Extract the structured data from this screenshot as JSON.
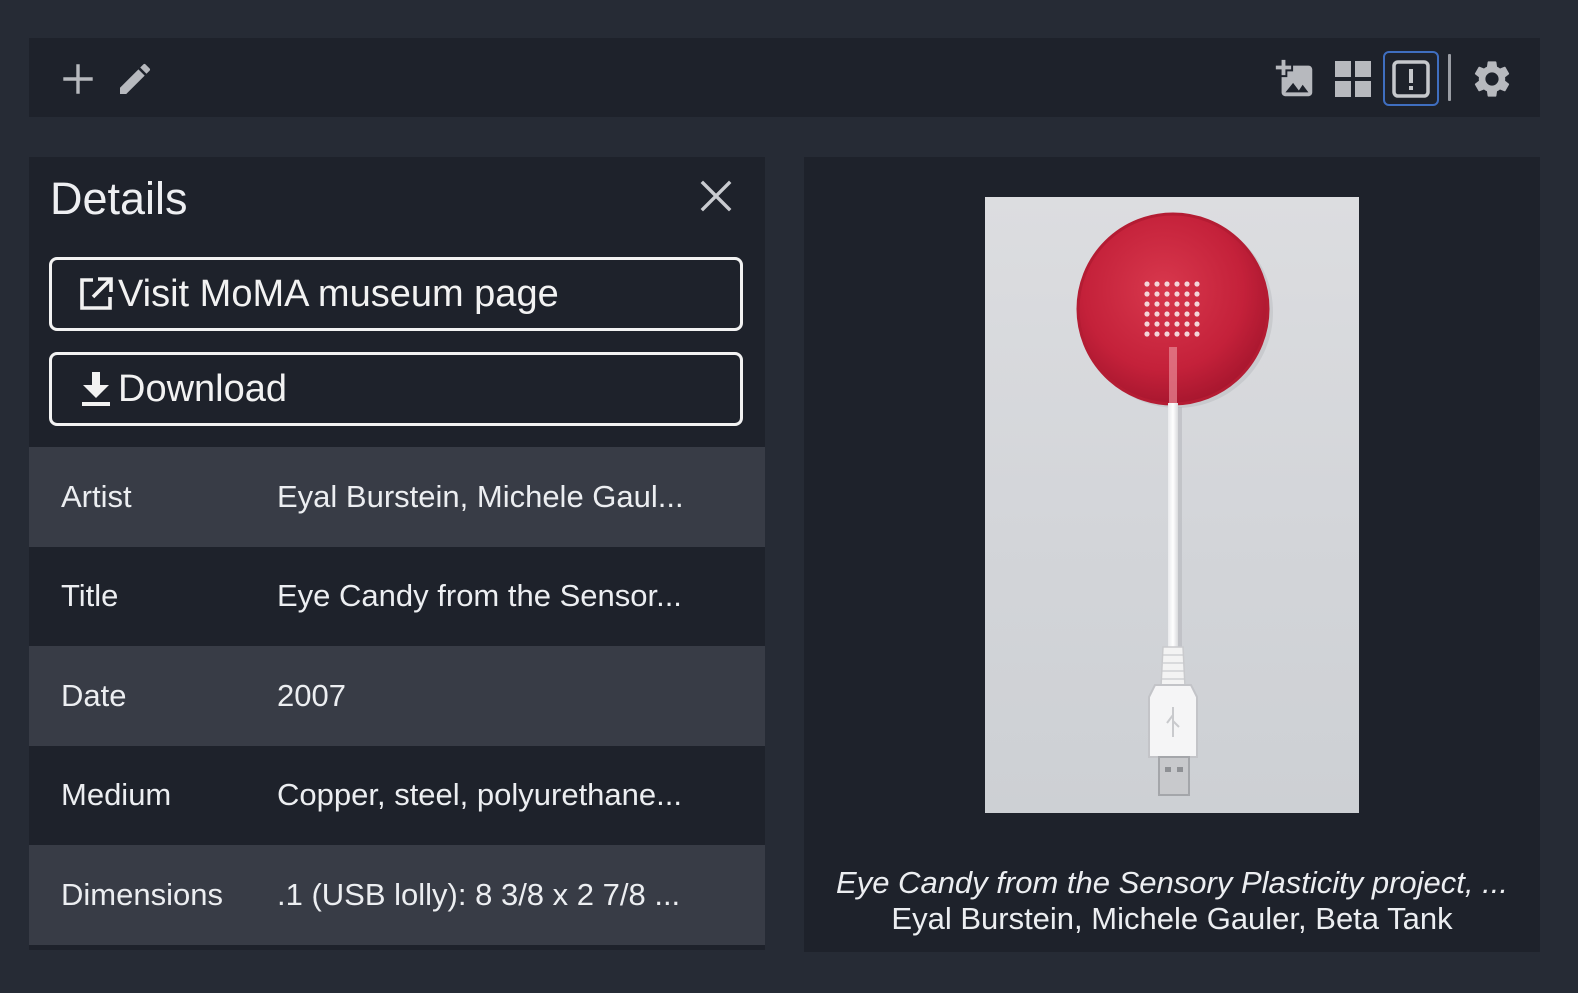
{
  "toolbar": {
    "left_buttons": [
      {
        "icon": "plus-icon",
        "label": "Add"
      },
      {
        "icon": "pencil-icon",
        "label": "Edit"
      }
    ],
    "right_buttons": [
      {
        "icon": "add-image-icon"
      },
      {
        "icon": "grid-icon"
      },
      {
        "icon": "details-icon",
        "active": true
      },
      {
        "icon": "gear-icon"
      }
    ],
    "active_outline_color": "#3f6ec0"
  },
  "details": {
    "title": "Details",
    "close_icon": "close-icon",
    "visit_button": {
      "icon": "external-link-icon",
      "label": "Visit MoMA museum page"
    },
    "download_button": {
      "icon": "download-icon",
      "label": "Download"
    },
    "rows": [
      {
        "key": "Artist",
        "value": "Eyal Burstein, Michele Gaul..."
      },
      {
        "key": "Title",
        "value": "Eye Candy from the Sensor..."
      },
      {
        "key": "Date",
        "value": "2007"
      },
      {
        "key": "Medium",
        "value": "Copper, steel, polyurethane..."
      },
      {
        "key": "Dimensions",
        "value": ".1 (USB lolly): 8 3/8 x 2 7/8 ..."
      }
    ]
  },
  "viewer": {
    "image_subject": "red lollipop with white USB connector stick",
    "caption_title": "Eye Candy from the Sensory Plasticity project, ...",
    "caption_artist": "Eyal Burstein, Michele Gauler, Beta Tank"
  },
  "colors": {
    "background": "#262b35",
    "panel": "#1e222b",
    "row_alt": "#383c46",
    "lolly_red": "#c8233a"
  }
}
